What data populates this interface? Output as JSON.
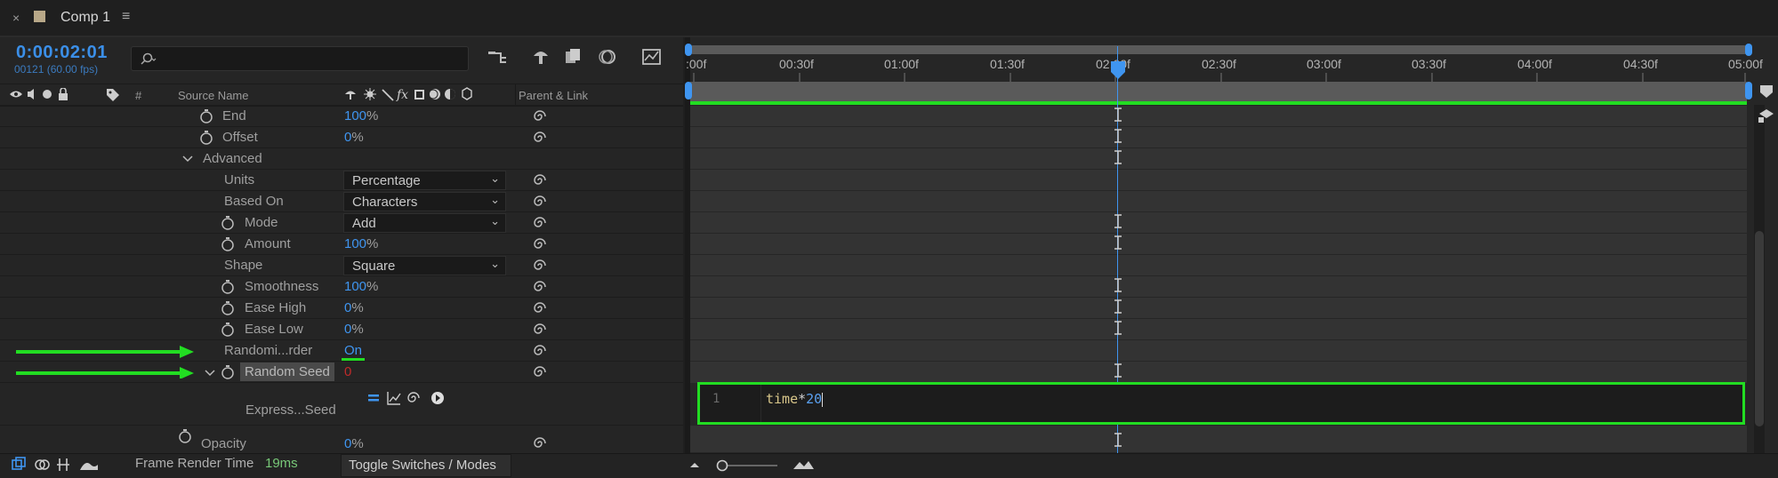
{
  "tab": {
    "close": "×",
    "title": "Comp 1",
    "menu": "≡"
  },
  "timecode": {
    "value": "0:00:02:01",
    "frames": "00121 (60.00 fps)"
  },
  "search": {
    "placeholder": ""
  },
  "header": {
    "hash": "#",
    "source_name": "Source Name",
    "parent_link": "Parent & Link"
  },
  "properties": [
    {
      "label": "End",
      "value": "100",
      "unit": "%"
    },
    {
      "label": "Offset",
      "value": "0",
      "unit": "%"
    },
    {
      "label": "Advanced"
    },
    {
      "label": "Units",
      "dropdown": "Percentage"
    },
    {
      "label": "Based On",
      "dropdown": "Characters"
    },
    {
      "label": "Mode",
      "dropdown": "Add"
    },
    {
      "label": "Amount",
      "value": "100",
      "unit": "%"
    },
    {
      "label": "Shape",
      "dropdown": "Square"
    },
    {
      "label": "Smoothness",
      "value": "100",
      "unit": "%"
    },
    {
      "label": "Ease High",
      "value": "0",
      "unit": "%"
    },
    {
      "label": "Ease Low",
      "value": "0",
      "unit": "%"
    },
    {
      "label": "Randomi...rder",
      "value": "On"
    },
    {
      "label": "Random Seed",
      "value": "0"
    },
    {
      "label": "Express...Seed"
    },
    {
      "label": "Opacity",
      "value": "0",
      "unit": "%"
    }
  ],
  "ruler": {
    "labels": [
      ":00f",
      "00:30f",
      "01:00f",
      "01:30f",
      "02:00f",
      "02:30f",
      "03:00f",
      "03:30f",
      "04:00f",
      "04:30f",
      "05:00f"
    ]
  },
  "expression": {
    "line_number": "1",
    "code_word": "time",
    "code_op": "*",
    "code_num": "20"
  },
  "bottom": {
    "frame_render_label": "Frame Render Time",
    "frame_render_value": "19ms",
    "toggle": "Toggle Switches / Modes"
  },
  "colors": {
    "accent_blue": "#3f95f0",
    "highlight_green": "#22dd22",
    "red_value": "#c02a2a"
  }
}
